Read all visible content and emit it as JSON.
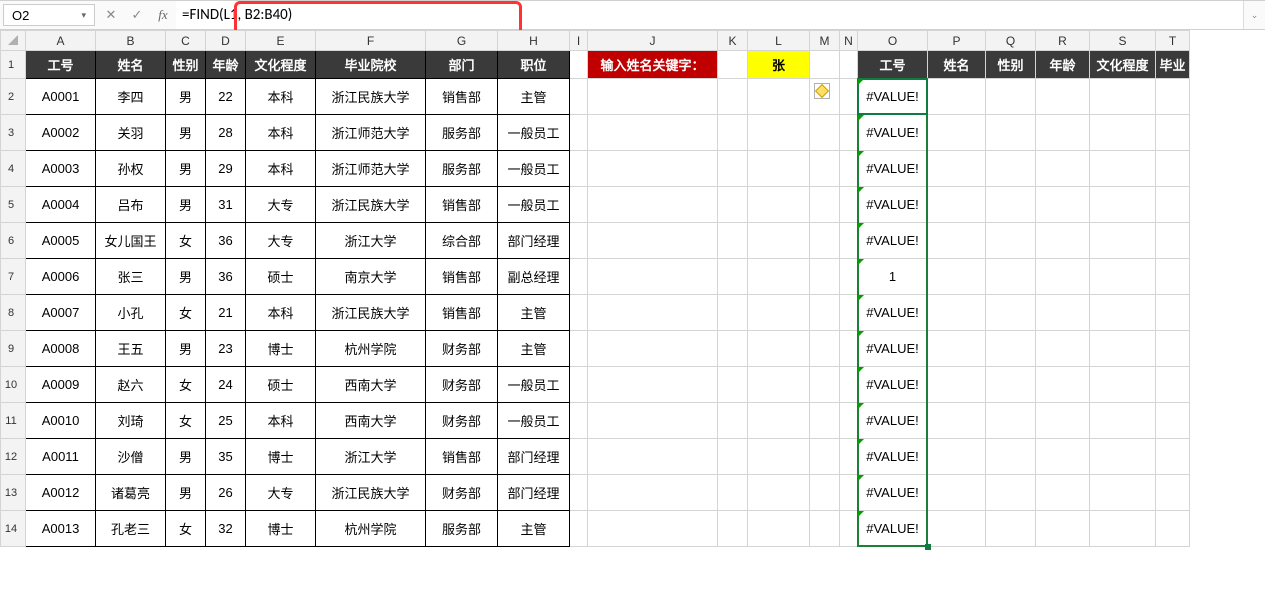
{
  "nameBox": {
    "value": "O2"
  },
  "formulaBar": {
    "formula": "=FIND(L1, B2:B40)"
  },
  "columns": [
    "A",
    "B",
    "C",
    "D",
    "E",
    "F",
    "G",
    "H",
    "I",
    "J",
    "K",
    "L",
    "M",
    "N",
    "O",
    "P",
    "Q",
    "R",
    "S",
    "T"
  ],
  "headerRow": {
    "A": "工号",
    "B": "姓名",
    "C": "性别",
    "D": "年龄",
    "E": "文化程度",
    "F": "毕业院校",
    "G": "部门",
    "H": "职位",
    "J": "输入姓名关键字：",
    "L": "张",
    "O": "工号",
    "P": "姓名",
    "Q": "性别",
    "R": "年龄",
    "S": "文化程度",
    "T": "毕业"
  },
  "rows": [
    {
      "n": 2,
      "A": "A0001",
      "B": "李四",
      "C": "男",
      "D": "22",
      "E": "本科",
      "F": "浙江民族大学",
      "G": "销售部",
      "H": "主管",
      "O": "#VALUE!"
    },
    {
      "n": 3,
      "A": "A0002",
      "B": "关羽",
      "C": "男",
      "D": "28",
      "E": "本科",
      "F": "浙江师范大学",
      "G": "服务部",
      "H": "一般员工",
      "O": "#VALUE!"
    },
    {
      "n": 4,
      "A": "A0003",
      "B": "孙权",
      "C": "男",
      "D": "29",
      "E": "本科",
      "F": "浙江师范大学",
      "G": "服务部",
      "H": "一般员工",
      "O": "#VALUE!"
    },
    {
      "n": 5,
      "A": "A0004",
      "B": "吕布",
      "C": "男",
      "D": "31",
      "E": "大专",
      "F": "浙江民族大学",
      "G": "销售部",
      "H": "一般员工",
      "O": "#VALUE!"
    },
    {
      "n": 6,
      "A": "A0005",
      "B": "女儿国王",
      "C": "女",
      "D": "36",
      "E": "大专",
      "F": "浙江大学",
      "G": "综合部",
      "H": "部门经理",
      "O": "#VALUE!"
    },
    {
      "n": 7,
      "A": "A0006",
      "B": "张三",
      "C": "男",
      "D": "36",
      "E": "硕士",
      "F": "南京大学",
      "G": "销售部",
      "H": "副总经理",
      "O": "1"
    },
    {
      "n": 8,
      "A": "A0007",
      "B": "小孔",
      "C": "女",
      "D": "21",
      "E": "本科",
      "F": "浙江民族大学",
      "G": "销售部",
      "H": "主管",
      "O": "#VALUE!"
    },
    {
      "n": 9,
      "A": "A0008",
      "B": "王五",
      "C": "男",
      "D": "23",
      "E": "博士",
      "F": "杭州学院",
      "G": "财务部",
      "H": "主管",
      "O": "#VALUE!"
    },
    {
      "n": 10,
      "A": "A0009",
      "B": "赵六",
      "C": "女",
      "D": "24",
      "E": "硕士",
      "F": "西南大学",
      "G": "财务部",
      "H": "一般员工",
      "O": "#VALUE!"
    },
    {
      "n": 11,
      "A": "A0010",
      "B": "刘琦",
      "C": "女",
      "D": "25",
      "E": "本科",
      "F": "西南大学",
      "G": "财务部",
      "H": "一般员工",
      "O": "#VALUE!"
    },
    {
      "n": 12,
      "A": "A0011",
      "B": "沙僧",
      "C": "男",
      "D": "35",
      "E": "博士",
      "F": "浙江大学",
      "G": "销售部",
      "H": "部门经理",
      "O": "#VALUE!"
    },
    {
      "n": 13,
      "A": "A0012",
      "B": "诸葛亮",
      "C": "男",
      "D": "26",
      "E": "大专",
      "F": "浙江民族大学",
      "G": "财务部",
      "H": "部门经理",
      "O": "#VALUE!"
    },
    {
      "n": 14,
      "A": "A0013",
      "B": "孔老三",
      "C": "女",
      "D": "32",
      "E": "博士",
      "F": "杭州学院",
      "G": "服务部",
      "H": "主管",
      "O": "#VALUE!"
    }
  ],
  "icons": {
    "cancel": "✕",
    "enter": "✓",
    "fx": "fx",
    "dd": "▾",
    "expand": "⌄"
  }
}
